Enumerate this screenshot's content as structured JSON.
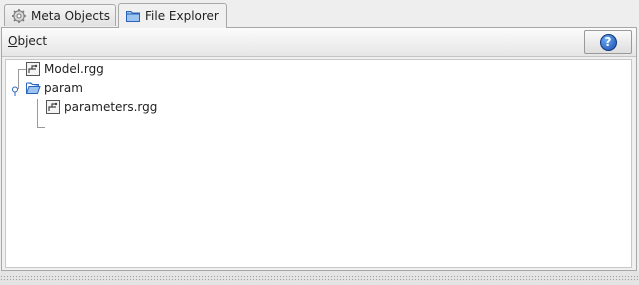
{
  "tabs": [
    {
      "label": "Meta Objects",
      "icon": "gear-icon",
      "active": false
    },
    {
      "label": "File Explorer",
      "icon": "folder-icon",
      "active": true
    }
  ],
  "header": {
    "title_mnemonic": "O",
    "title_rest": "bject",
    "help_symbol": "?"
  },
  "tree": {
    "items": [
      {
        "label": "Model.rgg",
        "icon": "rgg-file-icon"
      },
      {
        "label": "param",
        "icon": "folder-open-icon"
      },
      {
        "label": "parameters.rgg",
        "icon": "rgg-file-icon"
      }
    ]
  }
}
